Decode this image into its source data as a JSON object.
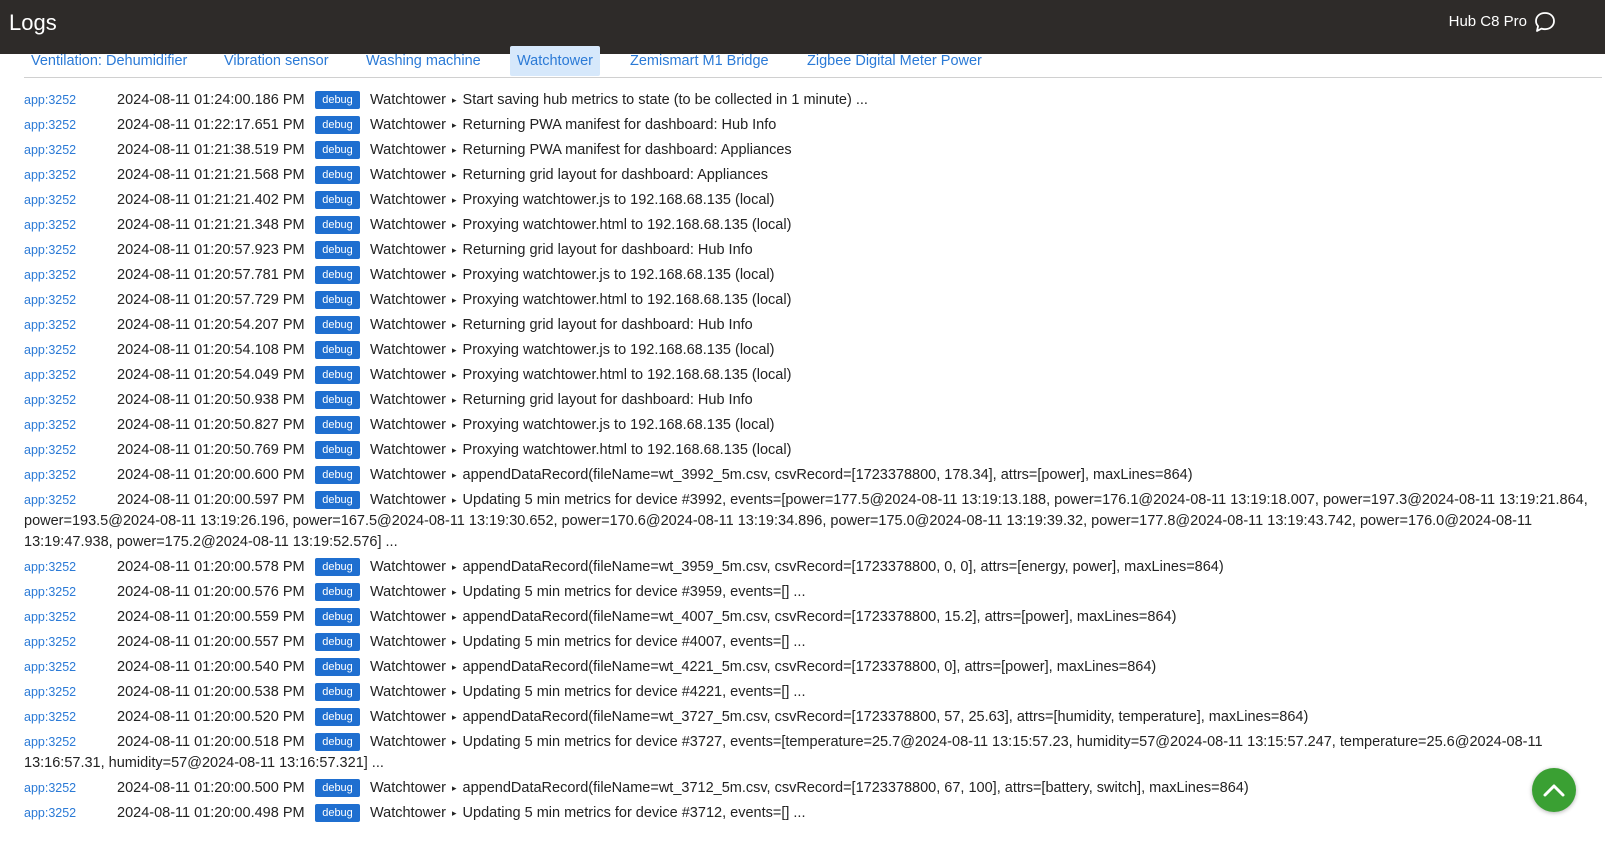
{
  "header": {
    "title": "Logs",
    "hub_name": "Hub C8 Pro",
    "chat_icon": "chat-bubble-icon"
  },
  "tabs": [
    {
      "label": "Ventilation: Dehumidifier",
      "active": false
    },
    {
      "label": "Vibration sensor",
      "active": false
    },
    {
      "label": "Washing machine",
      "active": false
    },
    {
      "label": "Watchtower",
      "active": true
    },
    {
      "label": "Zemismart M1 Bridge",
      "active": false
    },
    {
      "label": "Zigbee Digital Meter Power",
      "active": false
    }
  ],
  "logs": [
    {
      "app": "app:3252",
      "time": "2024-08-11 01:24:00.186 PM",
      "level": "debug",
      "source": "Watchtower",
      "message": "Start saving hub metrics to state (to be collected in 1 minute) ..."
    },
    {
      "app": "app:3252",
      "time": "2024-08-11 01:22:17.651 PM",
      "level": "debug",
      "source": "Watchtower",
      "message": "Returning PWA manifest for dashboard: Hub Info"
    },
    {
      "app": "app:3252",
      "time": "2024-08-11 01:21:38.519 PM",
      "level": "debug",
      "source": "Watchtower",
      "message": "Returning PWA manifest for dashboard: Appliances"
    },
    {
      "app": "app:3252",
      "time": "2024-08-11 01:21:21.568 PM",
      "level": "debug",
      "source": "Watchtower",
      "message": "Returning grid layout for dashboard: Appliances"
    },
    {
      "app": "app:3252",
      "time": "2024-08-11 01:21:21.402 PM",
      "level": "debug",
      "source": "Watchtower",
      "message": "Proxying watchtower.js to 192.168.68.135 (local)"
    },
    {
      "app": "app:3252",
      "time": "2024-08-11 01:21:21.348 PM",
      "level": "debug",
      "source": "Watchtower",
      "message": "Proxying watchtower.html to 192.168.68.135 (local)"
    },
    {
      "app": "app:3252",
      "time": "2024-08-11 01:20:57.923 PM",
      "level": "debug",
      "source": "Watchtower",
      "message": "Returning grid layout for dashboard: Hub Info"
    },
    {
      "app": "app:3252",
      "time": "2024-08-11 01:20:57.781 PM",
      "level": "debug",
      "source": "Watchtower",
      "message": "Proxying watchtower.js to 192.168.68.135 (local)"
    },
    {
      "app": "app:3252",
      "time": "2024-08-11 01:20:57.729 PM",
      "level": "debug",
      "source": "Watchtower",
      "message": "Proxying watchtower.html to 192.168.68.135 (local)"
    },
    {
      "app": "app:3252",
      "time": "2024-08-11 01:20:54.207 PM",
      "level": "debug",
      "source": "Watchtower",
      "message": "Returning grid layout for dashboard: Hub Info"
    },
    {
      "app": "app:3252",
      "time": "2024-08-11 01:20:54.108 PM",
      "level": "debug",
      "source": "Watchtower",
      "message": "Proxying watchtower.js to 192.168.68.135 (local)"
    },
    {
      "app": "app:3252",
      "time": "2024-08-11 01:20:54.049 PM",
      "level": "debug",
      "source": "Watchtower",
      "message": "Proxying watchtower.html to 192.168.68.135 (local)"
    },
    {
      "app": "app:3252",
      "time": "2024-08-11 01:20:50.938 PM",
      "level": "debug",
      "source": "Watchtower",
      "message": "Returning grid layout for dashboard: Hub Info"
    },
    {
      "app": "app:3252",
      "time": "2024-08-11 01:20:50.827 PM",
      "level": "debug",
      "source": "Watchtower",
      "message": "Proxying watchtower.js to 192.168.68.135 (local)"
    },
    {
      "app": "app:3252",
      "time": "2024-08-11 01:20:50.769 PM",
      "level": "debug",
      "source": "Watchtower",
      "message": "Proxying watchtower.html to 192.168.68.135 (local)"
    },
    {
      "app": "app:3252",
      "time": "2024-08-11 01:20:00.600 PM",
      "level": "debug",
      "source": "Watchtower",
      "message": "appendDataRecord(fileName=wt_3992_5m.csv, csvRecord=[1723378800, 178.34], attrs=[power], maxLines=864)"
    },
    {
      "app": "app:3252",
      "time": "2024-08-11 01:20:00.597 PM",
      "level": "debug",
      "source": "Watchtower",
      "message": "Updating 5 min metrics for device #3992, events=[power=177.5@2024-08-11 13:19:13.188, power=176.1@2024-08-11 13:19:18.007, power=197.3@2024-08-11 13:19:21.864, power=193.5@2024-08-11 13:19:26.196, power=167.5@2024-08-11 13:19:30.652, power=170.6@2024-08-11 13:19:34.896, power=175.0@2024-08-11 13:19:39.32, power=177.8@2024-08-11 13:19:43.742, power=176.0@2024-08-11 13:19:47.938, power=175.2@2024-08-11 13:19:52.576] ..."
    },
    {
      "app": "app:3252",
      "time": "2024-08-11 01:20:00.578 PM",
      "level": "debug",
      "source": "Watchtower",
      "message": "appendDataRecord(fileName=wt_3959_5m.csv, csvRecord=[1723378800, 0, 0], attrs=[energy, power], maxLines=864)"
    },
    {
      "app": "app:3252",
      "time": "2024-08-11 01:20:00.576 PM",
      "level": "debug",
      "source": "Watchtower",
      "message": "Updating 5 min metrics for device #3959, events=[] ..."
    },
    {
      "app": "app:3252",
      "time": "2024-08-11 01:20:00.559 PM",
      "level": "debug",
      "source": "Watchtower",
      "message": "appendDataRecord(fileName=wt_4007_5m.csv, csvRecord=[1723378800, 15.2], attrs=[power], maxLines=864)"
    },
    {
      "app": "app:3252",
      "time": "2024-08-11 01:20:00.557 PM",
      "level": "debug",
      "source": "Watchtower",
      "message": "Updating 5 min metrics for device #4007, events=[] ..."
    },
    {
      "app": "app:3252",
      "time": "2024-08-11 01:20:00.540 PM",
      "level": "debug",
      "source": "Watchtower",
      "message": "appendDataRecord(fileName=wt_4221_5m.csv, csvRecord=[1723378800, 0], attrs=[power], maxLines=864)"
    },
    {
      "app": "app:3252",
      "time": "2024-08-11 01:20:00.538 PM",
      "level": "debug",
      "source": "Watchtower",
      "message": "Updating 5 min metrics for device #4221, events=[] ..."
    },
    {
      "app": "app:3252",
      "time": "2024-08-11 01:20:00.520 PM",
      "level": "debug",
      "source": "Watchtower",
      "message": "appendDataRecord(fileName=wt_3727_5m.csv, csvRecord=[1723378800, 57, 25.63], attrs=[humidity, temperature], maxLines=864)"
    },
    {
      "app": "app:3252",
      "time": "2024-08-11 01:20:00.518 PM",
      "level": "debug",
      "source": "Watchtower",
      "message": "Updating 5 min metrics for device #3727, events=[temperature=25.7@2024-08-11 13:15:57.23, humidity=57@2024-08-11 13:15:57.247, temperature=25.6@2024-08-11 13:16:57.31, humidity=57@2024-08-11 13:16:57.321] ..."
    },
    {
      "app": "app:3252",
      "time": "2024-08-11 01:20:00.500 PM",
      "level": "debug",
      "source": "Watchtower",
      "message": "appendDataRecord(fileName=wt_3712_5m.csv, csvRecord=[1723378800, 67, 100], attrs=[battery, switch], maxLines=864)"
    },
    {
      "app": "app:3252",
      "time": "2024-08-11 01:20:00.498 PM",
      "level": "debug",
      "source": "Watchtower",
      "message": "Updating 5 min metrics for device #3712, events=[] ..."
    }
  ],
  "scroll_top_icon": "chevron-up-icon",
  "colors": {
    "header_bg": "#2e2b29",
    "link": "#2b7ad6",
    "debug_badge": "#1f6fd0",
    "fab": "#3aa033",
    "active_tab_bg": "#d6e8fb"
  }
}
